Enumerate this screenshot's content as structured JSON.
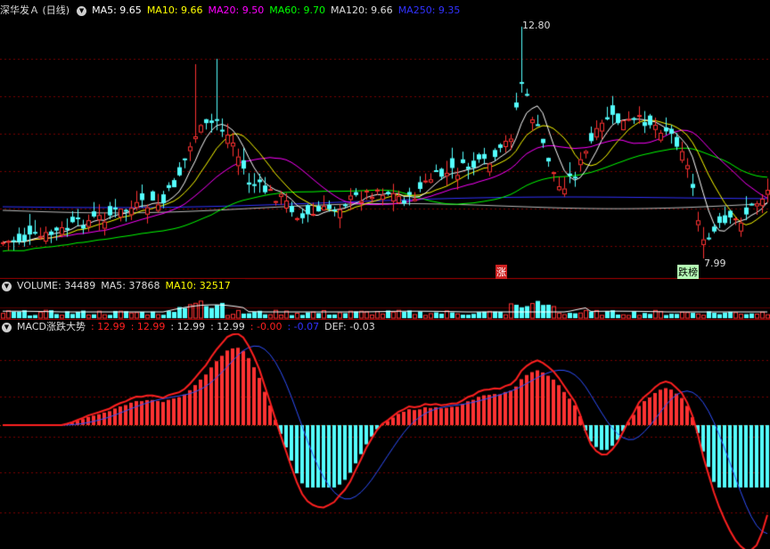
{
  "colors": {
    "background": "#000000",
    "up": "#ff3232",
    "down": "#54ffff",
    "grid": "#7a0000",
    "ma5": "#ffffff",
    "ma10": "#ffff00",
    "ma20": "#ff00ff",
    "ma60": "#00ff00",
    "ma120": "#bbbbbb",
    "ma250": "#3232ff",
    "macd_line": "#ff2020",
    "macd_signal": "#3050ff"
  },
  "price_panel": {
    "title": "深华发Ａ (日线)",
    "indicators": [
      {
        "label": "MA5: 9.65",
        "color": "#ffffff"
      },
      {
        "label": "MA10: 9.66",
        "color": "#ffff00"
      },
      {
        "label": "MA20: 9.50",
        "color": "#ff00ff"
      },
      {
        "label": "MA60: 9.70",
        "color": "#00ff00"
      },
      {
        "label": "MA120: 9.66",
        "color": "#dddddd"
      },
      {
        "label": "MA250: 9.35",
        "color": "#3232ff"
      }
    ],
    "high_label": "12.80",
    "low_label": "7.99",
    "up_marker": "涨",
    "limit_down_marker": "跌榜"
  },
  "volume_panel": {
    "indicators": [
      {
        "label": "VOLUME: 34489",
        "color": "#dddddd"
      },
      {
        "label": "MA5: 37868",
        "color": "#dddddd"
      },
      {
        "label": "MA10: 32517",
        "color": "#ffff00"
      }
    ]
  },
  "macd_panel": {
    "title": "MACD涨跌大势",
    "values": [
      {
        "label": ": 12.99",
        "color": "#ff2020"
      },
      {
        "label": ": 12.99",
        "color": "#ff2020"
      },
      {
        "label": ": 12.99",
        "color": "#dddddd"
      },
      {
        "label": ": 12.99",
        "color": "#dddddd"
      },
      {
        "label": ": -0.00",
        "color": "#ff2020"
      },
      {
        "label": ": -0.07",
        "color": "#3232ff"
      },
      {
        "label": "DEF: -0.03",
        "color": "#dddddd"
      }
    ]
  }
}
